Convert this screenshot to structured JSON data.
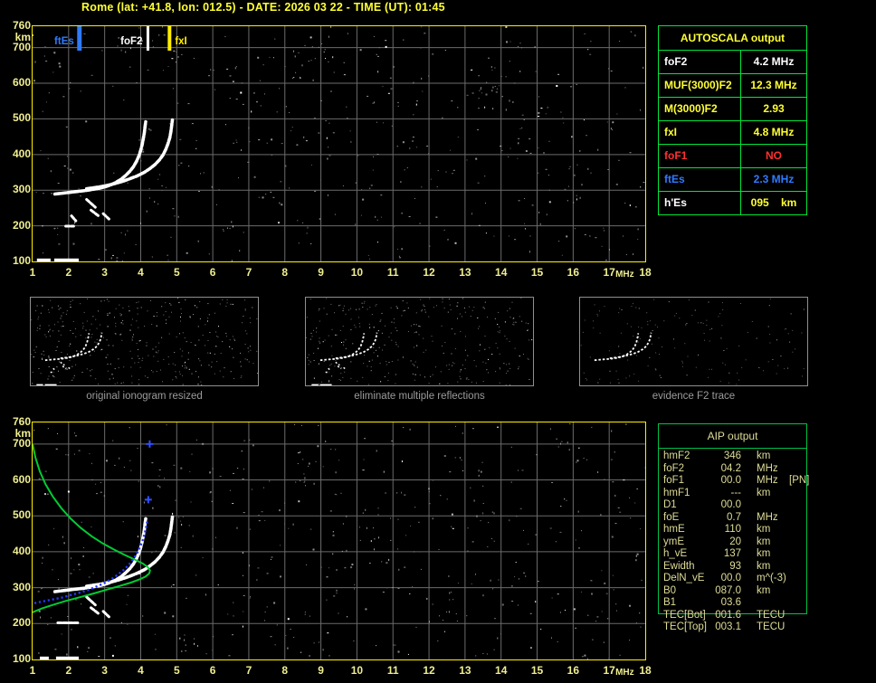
{
  "title": "Rome (lat: +41.8, lon: 012.5) - DATE: 2026 03 22 - TIME (UT): 01:45",
  "colors": {
    "background": "#000000",
    "title": "#ffff33",
    "axis_labels": "#f0ee90",
    "plot_border": "#ffee00",
    "grid": "#6b6b6b",
    "trace": "#ffffff",
    "noise": "#8f8f8f",
    "ftes_marker": "#2f7bff",
    "fof2_marker": "#ffffff",
    "fxi_marker": "#ffee00",
    "foF1_no": "#ff3030",
    "autoscala_border": "#00e63c",
    "aip_border": "#00c24a",
    "aip_text": "#dedc96",
    "profile_curve": "#00cc33",
    "restored_curve": "#2438ff",
    "thumb_border": "#8f8f8f",
    "caption_text": "#9b9b9b"
  },
  "autoscala_table": {
    "header": "AUTOSCALA output",
    "rows": [
      {
        "label": "foF2",
        "value": "4.2 MHz",
        "label_color": "#ffffff",
        "value_color": "#ffffff"
      },
      {
        "label": "MUF(3000)F2",
        "value": "12.3 MHz",
        "label_color": "#ffff33",
        "value_color": "#ffff33"
      },
      {
        "label": "M(3000)F2",
        "value": "2.93",
        "label_color": "#ffff33",
        "value_color": "#ffff33"
      },
      {
        "label": "fxI",
        "value": "4.8 MHz",
        "label_color": "#ffff33",
        "value_color": "#ffff33"
      },
      {
        "label": "foF1",
        "value": "NO",
        "label_color": "#ff3030",
        "value_color": "#ff3030"
      },
      {
        "label": "ftEs",
        "value": "2.3 MHz",
        "label_color": "#2f7bff",
        "value_color": "#2f7bff"
      },
      {
        "label": "h'Es",
        "value": "095    km",
        "label_color": "#ffffff",
        "value_color": "#ffff33"
      }
    ]
  },
  "aip_table": {
    "header": "AIP output",
    "rows": [
      {
        "label": "hmF2",
        "value": "346",
        "unit": "km",
        "note": ""
      },
      {
        "label": "foF2",
        "value": "04.2",
        "unit": "MHz",
        "note": ""
      },
      {
        "label": "foF1",
        "value": "00.0",
        "unit": "MHz",
        "note": "[PN]"
      },
      {
        "label": "hmF1",
        "value": "---",
        "unit": "km",
        "note": ""
      },
      {
        "label": "D1",
        "value": "00.0",
        "unit": "",
        "note": ""
      },
      {
        "label": "foE",
        "value": "0.7",
        "unit": "MHz",
        "note": ""
      },
      {
        "label": "hmE",
        "value": "110",
        "unit": "km",
        "note": ""
      },
      {
        "label": "ymE",
        "value": "20",
        "unit": "km",
        "note": ""
      },
      {
        "label": "h_vE",
        "value": "137",
        "unit": "km",
        "note": ""
      },
      {
        "label": "Ewidth",
        "value": "93",
        "unit": "km",
        "note": ""
      },
      {
        "label": "DelN_vE",
        "value": "00.0",
        "unit": "m^(-3)",
        "note": ""
      },
      {
        "label": "B0",
        "value": "087.0",
        "unit": "km",
        "note": ""
      },
      {
        "label": "B1",
        "value": "03.6",
        "unit": "",
        "note": ""
      },
      {
        "label": "TEC[Bot]",
        "value": "001.6",
        "unit": "TECU",
        "note": ""
      },
      {
        "label": "TEC[Top]",
        "value": "003.1",
        "unit": "TECU",
        "note": ""
      }
    ]
  },
  "thumbnails": [
    {
      "caption": "original ionogram resized"
    },
    {
      "caption": "eliminate multiple reflections"
    },
    {
      "caption": "evidence F2 trace"
    }
  ],
  "chart_data": [
    {
      "type": "scatter",
      "name": "ionogram with autoscaled characteristics",
      "xlabel": "MHz",
      "ylabel": "km",
      "xlim": [
        1,
        18
      ],
      "ylim": [
        100,
        760
      ],
      "x_ticks": [
        1,
        2,
        3,
        4,
        5,
        6,
        7,
        8,
        9,
        10,
        11,
        12,
        13,
        14,
        15,
        16,
        17,
        18
      ],
      "y_ticks": [
        760,
        700,
        600,
        500,
        400,
        300,
        200,
        100
      ],
      "grid": true,
      "markers": [
        {
          "label": "ftEs",
          "freq": 2.3,
          "color": "#2f7bff",
          "width": 5,
          "side": "left"
        },
        {
          "label": "foF2",
          "freq": 4.2,
          "color": "#ffffff",
          "width": 3,
          "side": "left"
        },
        {
          "label": "fxI",
          "freq": 4.8,
          "color": "#ffee00",
          "width": 4,
          "side": "right"
        }
      ],
      "o_trace": [
        [
          1.62,
          289
        ],
        [
          1.78,
          291
        ],
        [
          1.95,
          293
        ],
        [
          2.12,
          295
        ],
        [
          2.3,
          297
        ],
        [
          2.48,
          299
        ],
        [
          2.66,
          302
        ],
        [
          2.84,
          305
        ],
        [
          3.0,
          309
        ],
        [
          3.15,
          314
        ],
        [
          3.3,
          321
        ],
        [
          3.45,
          330
        ],
        [
          3.58,
          341
        ],
        [
          3.7,
          353
        ],
        [
          3.8,
          366
        ],
        [
          3.88,
          380
        ],
        [
          3.95,
          396
        ],
        [
          4.0,
          412
        ],
        [
          4.04,
          428
        ],
        [
          4.07,
          444
        ],
        [
          4.1,
          461
        ],
        [
          4.12,
          477
        ],
        [
          4.14,
          492
        ]
      ],
      "x_trace": [
        [
          2.5,
          304
        ],
        [
          2.7,
          307
        ],
        [
          2.9,
          310
        ],
        [
          3.1,
          314
        ],
        [
          3.3,
          319
        ],
        [
          3.5,
          325
        ],
        [
          3.7,
          332
        ],
        [
          3.9,
          340
        ],
        [
          4.1,
          350
        ],
        [
          4.25,
          360
        ],
        [
          4.4,
          372
        ],
        [
          4.52,
          385
        ],
        [
          4.62,
          399
        ],
        [
          4.7,
          415
        ],
        [
          4.76,
          431
        ],
        [
          4.81,
          448
        ],
        [
          4.84,
          465
        ],
        [
          4.86,
          481
        ],
        [
          4.88,
          497
        ]
      ],
      "es_trace": [
        [
          [
            1.12,
            103
          ],
          [
            1.5,
            103
          ]
        ],
        [
          [
            1.6,
            103
          ],
          [
            2.28,
            103
          ]
        ]
      ],
      "echo_fragments": [
        [
          [
            2.5,
            274
          ],
          [
            2.74,
            252
          ]
        ],
        [
          [
            2.62,
            244
          ],
          [
            2.84,
            227
          ]
        ],
        [
          [
            2.96,
            234
          ],
          [
            3.12,
            219
          ]
        ],
        [
          [
            2.08,
            228
          ],
          [
            2.2,
            214
          ]
        ],
        [
          [
            1.92,
            199
          ],
          [
            2.14,
            199
          ]
        ]
      ]
    },
    {
      "type": "scatter",
      "name": "ionogram with restored trace and electron density profile",
      "xlabel": "MHz",
      "ylabel": "km",
      "xlim": [
        1,
        18
      ],
      "ylim": [
        100,
        760
      ],
      "x_ticks": [
        1,
        2,
        3,
        4,
        5,
        6,
        7,
        8,
        9,
        10,
        11,
        12,
        13,
        14,
        15,
        16,
        17,
        18
      ],
      "y_ticks": [
        760,
        700,
        600,
        500,
        400,
        300,
        200,
        100
      ],
      "grid": true,
      "o_trace": [
        [
          1.62,
          289
        ],
        [
          1.78,
          291
        ],
        [
          1.95,
          293
        ],
        [
          2.12,
          295
        ],
        [
          2.3,
          297
        ],
        [
          2.48,
          299
        ],
        [
          2.66,
          302
        ],
        [
          2.84,
          305
        ],
        [
          3.0,
          309
        ],
        [
          3.15,
          314
        ],
        [
          3.3,
          321
        ],
        [
          3.45,
          330
        ],
        [
          3.58,
          341
        ],
        [
          3.7,
          353
        ],
        [
          3.8,
          366
        ],
        [
          3.88,
          380
        ],
        [
          3.95,
          396
        ],
        [
          4.0,
          412
        ],
        [
          4.04,
          428
        ],
        [
          4.07,
          444
        ],
        [
          4.1,
          461
        ],
        [
          4.12,
          477
        ],
        [
          4.14,
          492
        ]
      ],
      "x_trace": [
        [
          2.5,
          304
        ],
        [
          2.7,
          307
        ],
        [
          2.9,
          310
        ],
        [
          3.1,
          314
        ],
        [
          3.3,
          319
        ],
        [
          3.5,
          325
        ],
        [
          3.7,
          332
        ],
        [
          3.9,
          340
        ],
        [
          4.1,
          350
        ],
        [
          4.25,
          360
        ],
        [
          4.4,
          372
        ],
        [
          4.52,
          385
        ],
        [
          4.62,
          399
        ],
        [
          4.7,
          415
        ],
        [
          4.76,
          431
        ],
        [
          4.81,
          448
        ],
        [
          4.84,
          465
        ],
        [
          4.86,
          481
        ],
        [
          4.88,
          497
        ]
      ],
      "es_trace": [
        [
          [
            1.2,
            103
          ],
          [
            1.45,
            103
          ]
        ],
        [
          [
            1.65,
            103
          ],
          [
            2.28,
            103
          ]
        ]
      ],
      "echo_fragments": [
        [
          [
            2.5,
            274
          ],
          [
            2.74,
            252
          ]
        ],
        [
          [
            2.62,
            244
          ],
          [
            2.84,
            227
          ]
        ],
        [
          [
            2.96,
            234
          ],
          [
            3.12,
            219
          ]
        ],
        [
          [
            1.7,
            202
          ],
          [
            2.28,
            202
          ]
        ]
      ],
      "profile_trace": [
        [
          1.0,
          700
        ],
        [
          1.08,
          662
        ],
        [
          1.2,
          624
        ],
        [
          1.36,
          588
        ],
        [
          1.56,
          554
        ],
        [
          1.8,
          521
        ],
        [
          2.06,
          492
        ],
        [
          2.34,
          466
        ],
        [
          2.64,
          443
        ],
        [
          2.95,
          423
        ],
        [
          3.26,
          406
        ],
        [
          3.56,
          391
        ],
        [
          3.84,
          378
        ],
        [
          4.06,
          367
        ],
        [
          4.2,
          357
        ],
        [
          4.26,
          348
        ],
        [
          4.24,
          340
        ],
        [
          4.14,
          331
        ],
        [
          3.97,
          323
        ],
        [
          3.73,
          314
        ],
        [
          3.43,
          305
        ],
        [
          3.08,
          295
        ],
        [
          2.7,
          284
        ],
        [
          2.3,
          273
        ],
        [
          1.92,
          263
        ],
        [
          1.56,
          252
        ],
        [
          1.26,
          242
        ],
        [
          1.04,
          233
        ],
        [
          1.0,
          231
        ]
      ],
      "restored_trace": [
        [
          1.05,
          257
        ],
        [
          1.3,
          262
        ],
        [
          1.55,
          267
        ],
        [
          1.8,
          272
        ],
        [
          2.05,
          279
        ],
        [
          2.3,
          286
        ],
        [
          2.55,
          294
        ],
        [
          2.8,
          304
        ],
        [
          3.02,
          314
        ],
        [
          3.22,
          326
        ],
        [
          3.4,
          339
        ],
        [
          3.56,
          352
        ],
        [
          3.7,
          367
        ],
        [
          3.82,
          383
        ],
        [
          3.92,
          400
        ],
        [
          4.0,
          418
        ],
        [
          4.07,
          436
        ],
        [
          4.12,
          454
        ],
        [
          4.16,
          472
        ],
        [
          4.19,
          489
        ]
      ],
      "restored_marks": [
        [
          4.21,
          545
        ],
        [
          4.25,
          700
        ]
      ]
    }
  ]
}
